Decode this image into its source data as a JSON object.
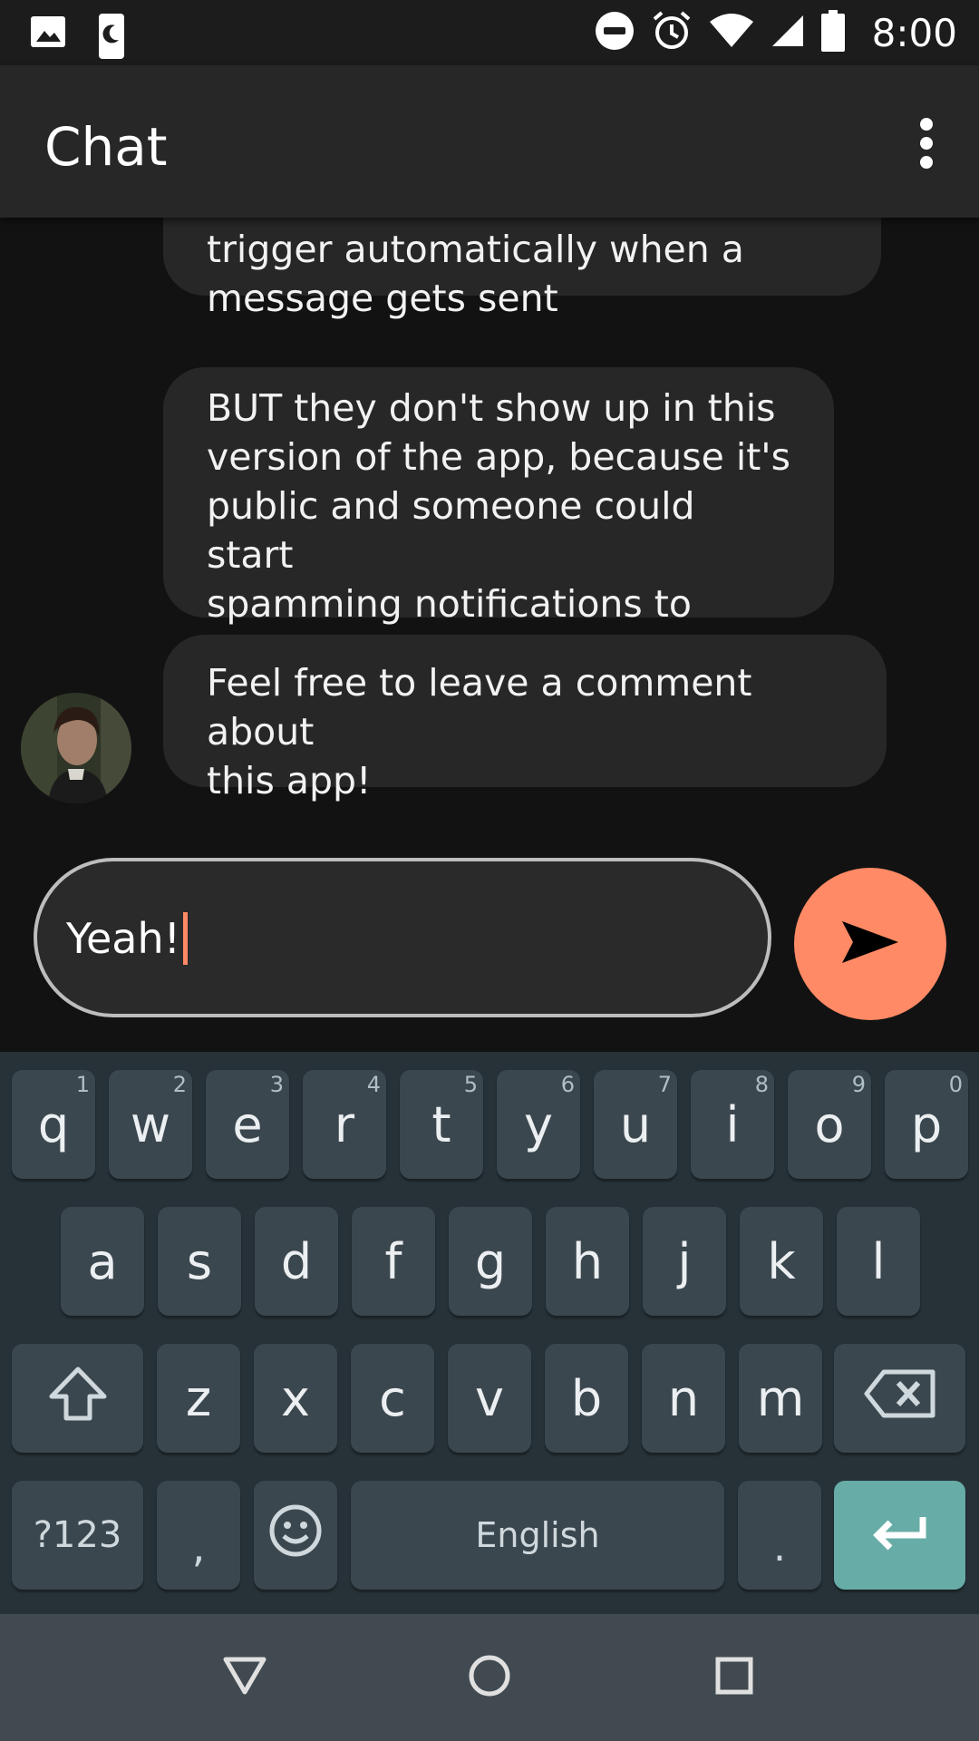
{
  "status_bar": {
    "time": "8:00",
    "left_icons": [
      "image-icon",
      "phone-moon-icon"
    ],
    "right_icons": [
      "do-not-disturb-icon",
      "alarm-icon",
      "wifi-icon",
      "signal-icon",
      "battery-icon"
    ]
  },
  "app_bar": {
    "title": "Chat",
    "menu_icon": "more-vertical-icon"
  },
  "messages": [
    {
      "lines": [
        "trigger automatically when a",
        "message gets sent"
      ]
    },
    {
      "lines": [
        "BUT they don't show up in this",
        "version of the app, because it's",
        "public and someone could start",
        "spamming notifications to others"
      ]
    },
    {
      "lines": [
        "Feel free to leave a comment about",
        "this app!"
      ]
    }
  ],
  "composer": {
    "value": "Yeah!",
    "send_icon": "send-icon",
    "accent_color": "#ff8a65"
  },
  "keyboard": {
    "row1": [
      {
        "ch": "q",
        "hint": "1"
      },
      {
        "ch": "w",
        "hint": "2"
      },
      {
        "ch": "e",
        "hint": "3"
      },
      {
        "ch": "r",
        "hint": "4"
      },
      {
        "ch": "t",
        "hint": "5"
      },
      {
        "ch": "y",
        "hint": "6"
      },
      {
        "ch": "u",
        "hint": "7"
      },
      {
        "ch": "i",
        "hint": "8"
      },
      {
        "ch": "o",
        "hint": "9"
      },
      {
        "ch": "p",
        "hint": "0"
      }
    ],
    "row2": [
      "a",
      "s",
      "d",
      "f",
      "g",
      "h",
      "j",
      "k",
      "l"
    ],
    "row3": [
      "z",
      "x",
      "c",
      "v",
      "b",
      "n",
      "m"
    ],
    "symbols_label": "?123",
    "comma_label": ",",
    "space_label": "English",
    "period_label": ".",
    "enter_color": "#67aca6"
  },
  "nav_bar": {
    "icons": [
      "back-icon",
      "home-icon",
      "recents-icon"
    ]
  }
}
